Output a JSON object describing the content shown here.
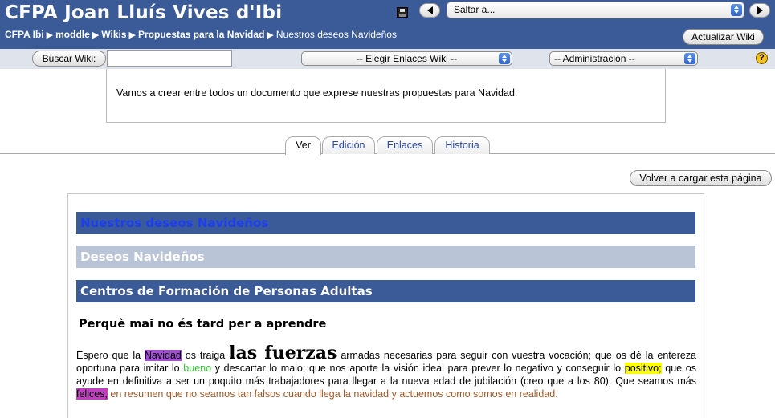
{
  "header": {
    "site_title": "CFPA Joan Lluís Vives d'Ibi",
    "jump_select": "Saltar a...",
    "breadcrumb": [
      "CFPA Ibi",
      "moddle",
      "Wikis",
      "Propuestas para la Navidad",
      "Nuestros deseos Navideños"
    ],
    "update_button": "Actualizar Wiki"
  },
  "toolbar": {
    "search_button": "Buscar Wiki:",
    "search_value": "",
    "links_select": "-- Elegir Enlaces Wiki --",
    "admin_select": "-- Administración --",
    "help_icon": "?"
  },
  "summary": "Vamos a crear entre todos un documento que exprese nuestras propuestas para Navidad.",
  "tabs": [
    {
      "label": "Ver",
      "active": true
    },
    {
      "label": "Edición",
      "active": false
    },
    {
      "label": "Enlaces",
      "active": false
    },
    {
      "label": "Historia",
      "active": false
    }
  ],
  "reload_button": "Volver a cargar esta página",
  "content": {
    "heading1": "Nuestros deseos Navideños",
    "heading2": "Deseos Navideños",
    "heading3": "Centros de Formación de Personas Adultas",
    "motto": "Perquè mai no és tard per a aprendre",
    "paragraph": {
      "p1": "Espero que la ",
      "hl_navidad": "Navidad",
      "p2": " os traiga ",
      "big": "las fuerzas",
      "p3": " armadas necesarias para seguir con vuestra vocación; que os dé la entereza oportuna para imitar lo ",
      "green_bueno": "bueno",
      "p4": " y descartar lo malo; que nos aporte la visión ideal para prever lo negativo y conseguir lo ",
      "hl_positivo": "positivo;",
      "p5": " que os ayude en definitiva a ser un poquito más trabajadores para llegar a la nueva edad de jubilación (creo que a los 80). Que seamos más ",
      "hl_felices": "felices,",
      "brown_end": " en resumen que no seamos tan falsos cuando llega la navidad y actuemos como somos en realidad."
    }
  },
  "colors": {
    "header_bg": "#3a5b98",
    "toolbar_bg": "#dfe4ec",
    "heading_light": "#b9c4d6",
    "highlight_purple": "#a050d0",
    "highlight_yellow": "#ffff00"
  }
}
